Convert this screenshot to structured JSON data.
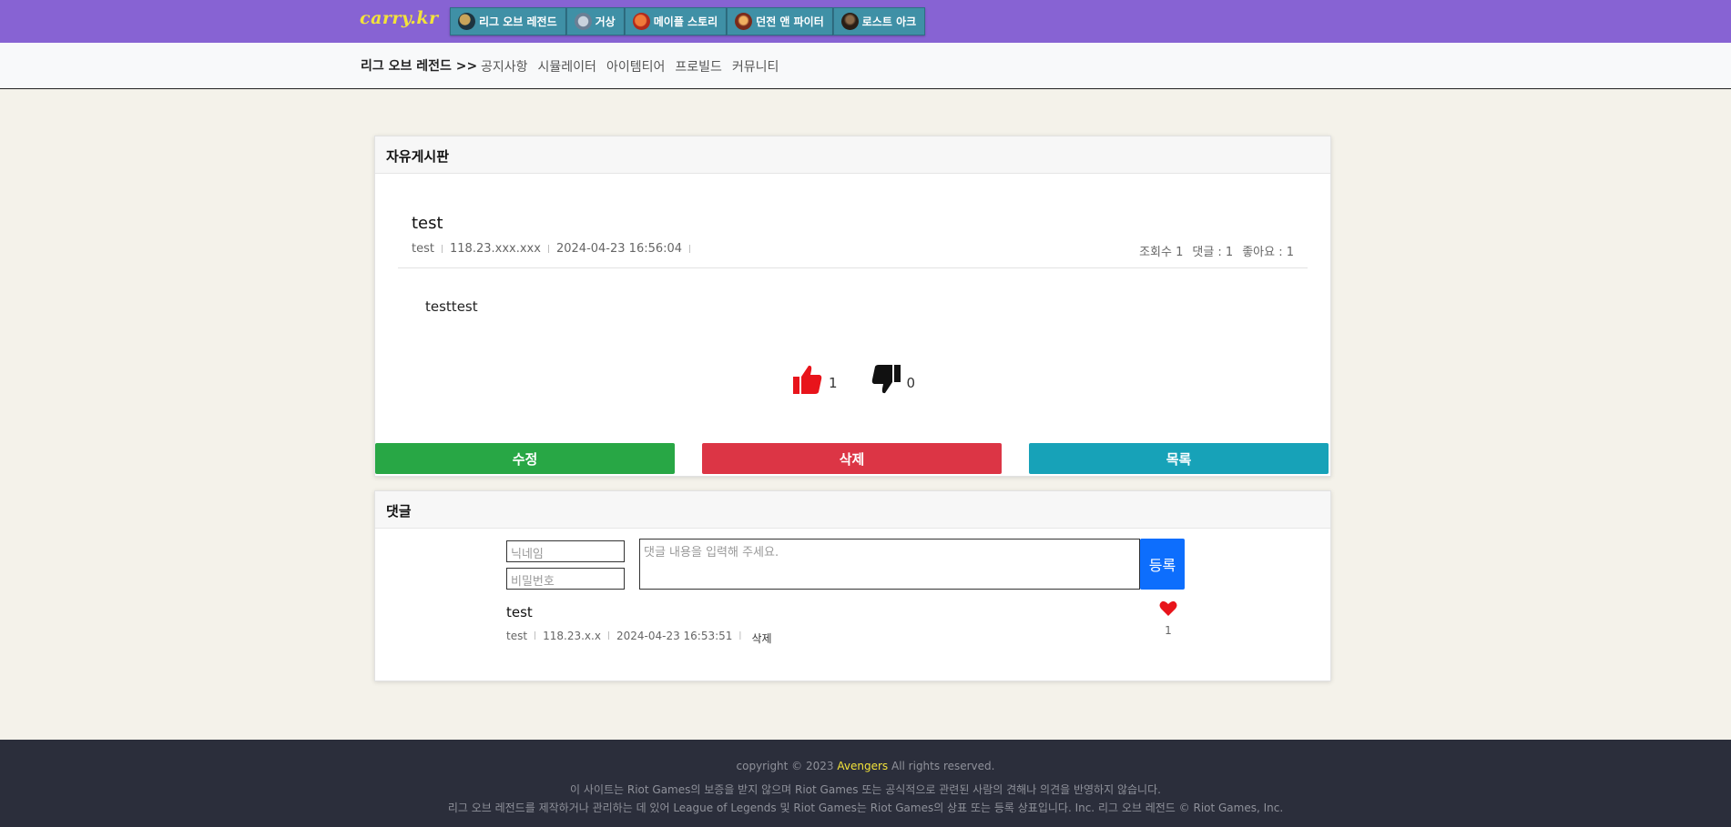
{
  "header": {
    "logo": "carry.kr",
    "games": [
      {
        "label": "리그 오브 레전드",
        "icon": "league-of-legends-icon",
        "color": "#1d3440"
      },
      {
        "label": "거상",
        "icon": "geosang-icon",
        "color": "#6a7f95"
      },
      {
        "label": "메이플 스토리",
        "icon": "maplestory-icon",
        "color": "#d9472b"
      },
      {
        "label": "던전 앤 파이터",
        "icon": "dungeon-fighter-icon",
        "color": "#b5462a"
      },
      {
        "label": "로스트 아크",
        "icon": "lost-ark-icon",
        "color": "#3b2c22"
      }
    ]
  },
  "subnav": {
    "title": "리그 오브 레전드 >>",
    "links": [
      "공지사항",
      "시뮬레이터",
      "아이템티어",
      "프로빌드",
      "커뮤니티"
    ]
  },
  "post": {
    "board_title": "자유게시판",
    "title": "test",
    "author": "test",
    "ip": "118.23.xxx.xxx",
    "date": "2024-04-23 16:56:04",
    "stats": {
      "views": "조회수 1",
      "comments": "댓글 : 1",
      "likes": "좋아요 : 1"
    },
    "body": "testtest",
    "upvotes": "1",
    "downvotes": "0",
    "buttons": {
      "edit": "수정",
      "delete": "삭제",
      "list": "목록"
    }
  },
  "comments": {
    "title": "댓글",
    "nickname_placeholder": "닉네임",
    "password_placeholder": "비밀번호",
    "content_placeholder": "댓글 내용을 입력해 주세요.",
    "submit": "등록",
    "items": [
      {
        "author": "test",
        "ip": "118.23.x.x",
        "date": "2024-04-23 16:53:51",
        "delete": "삭제",
        "likes": "1"
      }
    ]
  },
  "footer": {
    "copyright_prefix": "copyright © 2023",
    "brand": "Avengers",
    "copyright_suffix": "All rights reserved.",
    "disclaimer1": "이 사이트는 Riot Games의 보증을 받지 않으며 Riot Games 또는 공식적으로 관련된 사람의 견해나 의견을 반영하지 않습니다.",
    "disclaimer2": "리그 오브 레전드를 제작하거나 관리하는 데 있어 League of Legends 및 Riot Games는 Riot Games의 상표 또는 등록 상표입니다. Inc. 리그 오브 레전드 © Riot Games, Inc."
  },
  "colors": {
    "topbar": "#8763d3",
    "accent_logo": "#f3e33a",
    "edit": "#28a745",
    "delete": "#dc3545",
    "list": "#17a2b8",
    "submit": "#0d6efd",
    "upvote": "#e8141b"
  }
}
